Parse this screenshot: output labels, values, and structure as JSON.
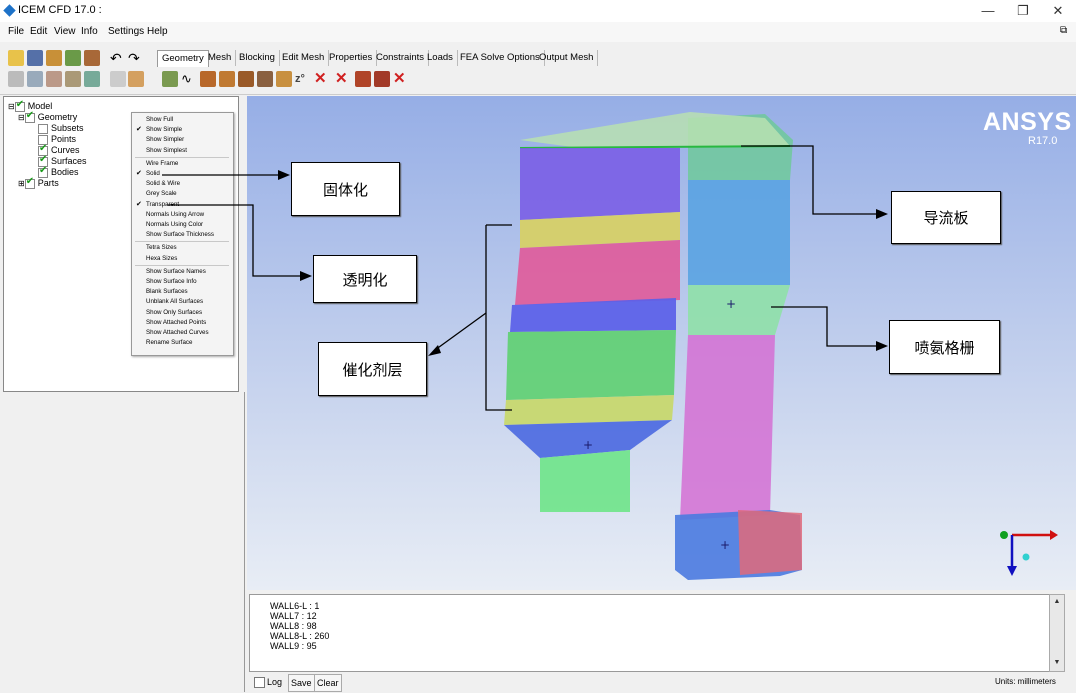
{
  "window": {
    "title": "ICEM CFD 17.0 :",
    "minimize": "—",
    "maximize": "❐",
    "close": "✕",
    "restore": "⧉"
  },
  "menu": [
    "File",
    "Edit",
    "View",
    "Info",
    "Settings",
    "Help"
  ],
  "tabs": [
    "Geometry",
    "Mesh",
    "Blocking",
    "Edit Mesh",
    "Properties",
    "Constraints",
    "Loads",
    "FEA Solve Options",
    "Output Mesh"
  ],
  "tree": {
    "model": "Model",
    "geometry": "Geometry",
    "subsets": "Subsets",
    "points": "Points",
    "curves": "Curves",
    "surfaces": "Surfaces",
    "bodies": "Bodies",
    "parts": "Parts"
  },
  "context_menu": [
    {
      "label": "Show Full",
      "checked": false
    },
    {
      "label": "Show Simple",
      "checked": true
    },
    {
      "label": "Show Simpler",
      "checked": false
    },
    {
      "label": "Show Simplest",
      "checked": false
    },
    {
      "label": "Wire Frame",
      "checked": false
    },
    {
      "label": "Solid",
      "checked": true
    },
    {
      "label": "Solid & Wire",
      "checked": false
    },
    {
      "label": "Grey Scale",
      "checked": false
    },
    {
      "label": "Transparent",
      "checked": true
    },
    {
      "label": "Normals Using Arrow",
      "checked": false
    },
    {
      "label": "Normals Using Color",
      "checked": false
    },
    {
      "label": "Show Surface Thickness",
      "checked": false
    },
    {
      "label": "Tetra Sizes",
      "checked": false
    },
    {
      "label": "Hexa Sizes",
      "checked": false
    },
    {
      "label": "Show Surface Names",
      "checked": false
    },
    {
      "label": "Show Surface Info",
      "checked": false
    },
    {
      "label": "Blank Surfaces",
      "checked": false
    },
    {
      "label": "Unblank All Surfaces",
      "checked": false
    },
    {
      "label": "Show Only Surfaces",
      "checked": false
    },
    {
      "label": "Show Attached Points",
      "checked": false
    },
    {
      "label": "Show Attached Curves",
      "checked": false
    },
    {
      "label": "Rename Surface",
      "checked": false
    }
  ],
  "viewport": {
    "brand": "ANSYS",
    "version": "R17.0"
  },
  "callouts": {
    "solid": "固体化",
    "transparent": "透明化",
    "catalyst": "催化剂层",
    "guide": "导流板",
    "ammonia": "喷氨格栅"
  },
  "messages": [
    "WALL6-L : 1",
    "WALL7 : 12",
    "WALL8 : 98",
    "WALL8-L : 260",
    "WALL9 : 95"
  ],
  "bottom": {
    "log": "Log",
    "save": "Save",
    "clear": "Clear",
    "units": "Units: millimeters"
  },
  "colors": {
    "accent": "#1e72c8",
    "viewport_top": "#96aee6",
    "axis_x": "#d01010",
    "axis_y": "#10a020",
    "axis_z": "#1010c0"
  }
}
